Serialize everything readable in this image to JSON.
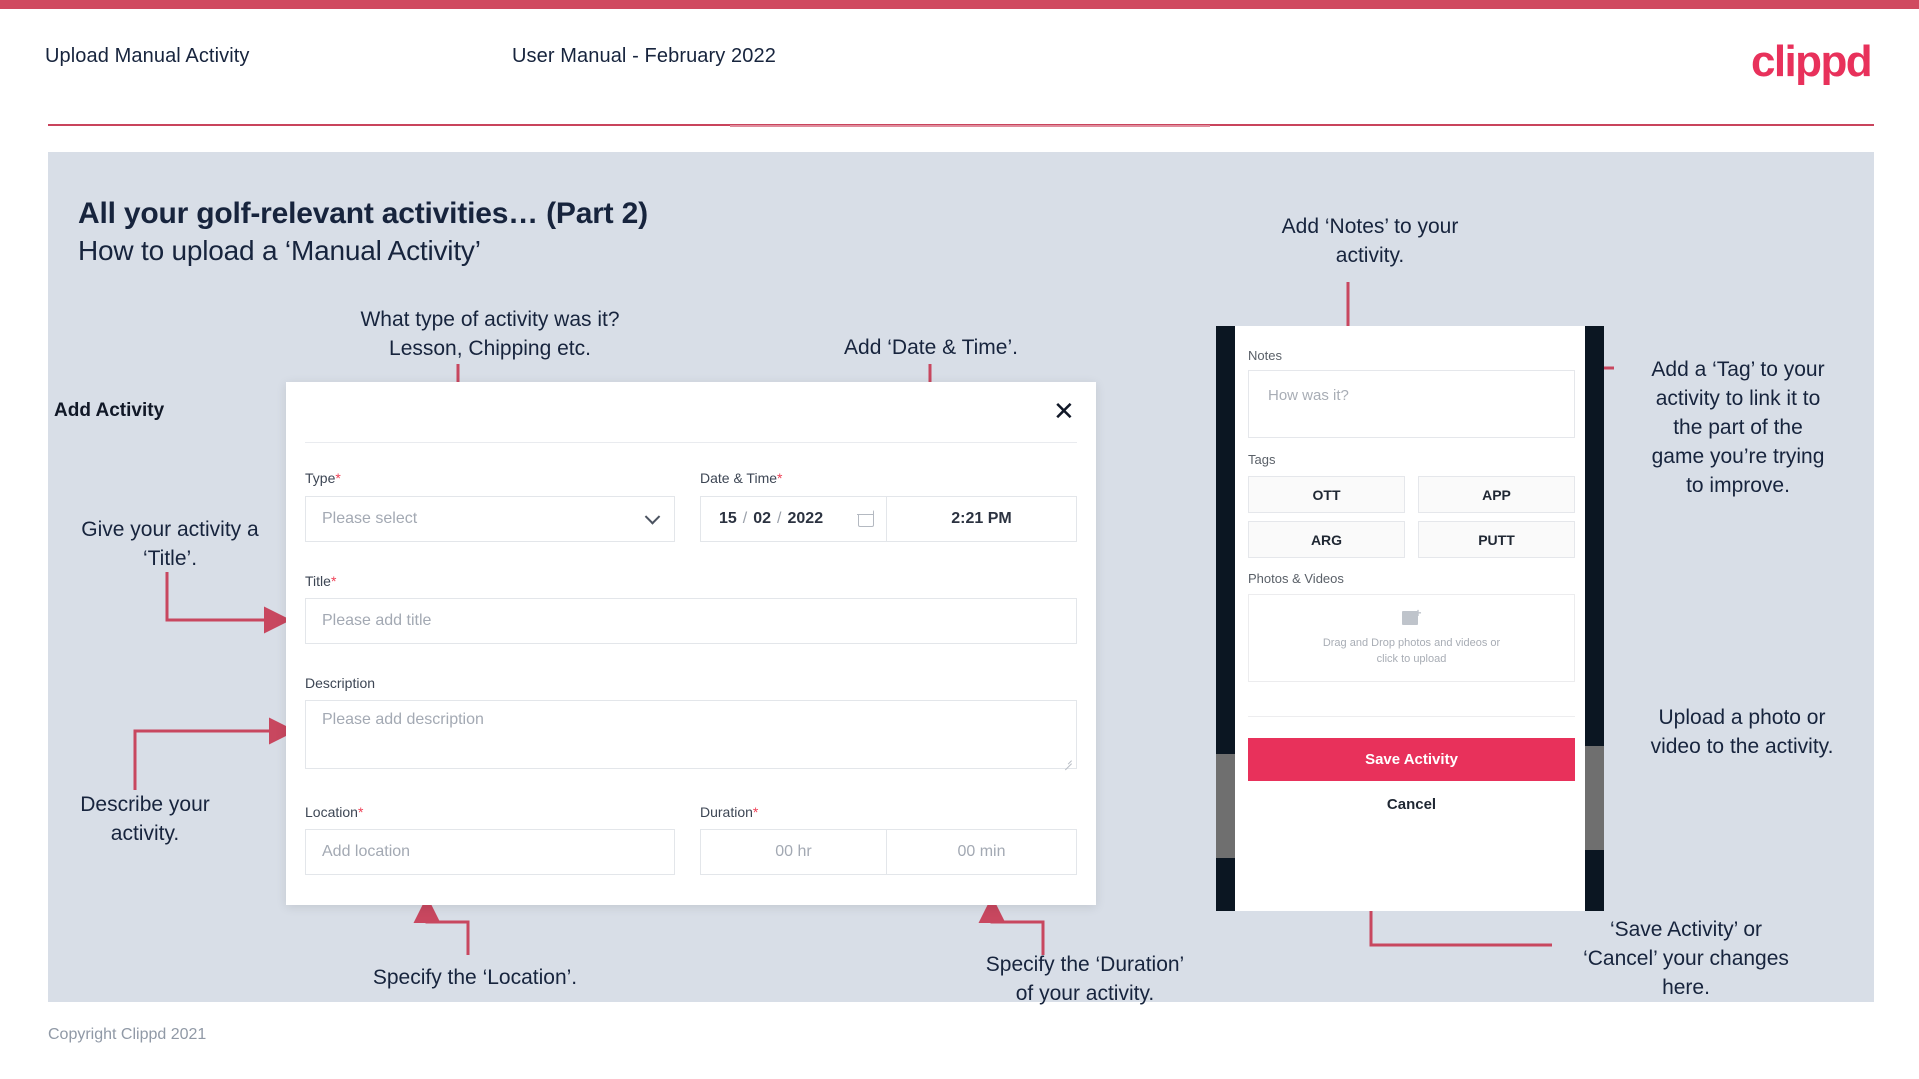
{
  "header": {
    "title": "Upload Manual Activity",
    "subtitle": "User Manual - February 2022",
    "logo": "clippd"
  },
  "slide": {
    "title": "All your golf-relevant activities… (Part 2)",
    "subtitle": "How to upload a ‘Manual Activity’"
  },
  "footer": {
    "copyright": "Copyright Clippd 2021"
  },
  "annotations": {
    "type": "What type of activity was it?\nLesson, Chipping etc.",
    "datetime": "Add ‘Date & Time’.",
    "title": "Give your activity a\n‘Title’.",
    "description": "Describe your\nactivity.",
    "location": "Specify the ‘Location’.",
    "duration": "Specify the ‘Duration’\nof your activity.",
    "notes": "Add ‘Notes’ to your\nactivity.",
    "tags": "Add a ‘Tag’ to your\nactivity to link it to\nthe part of the\ngame you’re trying\nto improve.",
    "upload": "Upload a photo or\nvideo to the activity.",
    "save_cancel": "‘Save Activity’ or\n‘Cancel’ your changes\nhere."
  },
  "dialog": {
    "title": "Add Activity",
    "close_icon": "close-icon",
    "fields": {
      "type": {
        "label": "Type",
        "required": "*",
        "placeholder": "Please select"
      },
      "datetime": {
        "label": "Date & Time",
        "required": "*",
        "day": "15",
        "month": "02",
        "year": "2022",
        "sep1": "/",
        "sep2": "/",
        "time": "2:21 PM"
      },
      "title": {
        "label": "Title",
        "required": "*",
        "placeholder": "Please add title"
      },
      "description": {
        "label": "Description",
        "required": "",
        "placeholder": "Please add description"
      },
      "location": {
        "label": "Location",
        "required": "*",
        "placeholder": "Add location"
      },
      "duration": {
        "label": "Duration",
        "required": "*",
        "hours": "00 hr",
        "minutes": "00 min"
      }
    }
  },
  "phone": {
    "notes": {
      "label": "Notes",
      "placeholder": "How was it?"
    },
    "tags": {
      "label": "Tags",
      "items": [
        "OTT",
        "APP",
        "ARG",
        "PUTT"
      ]
    },
    "photos": {
      "label": "Photos & Videos",
      "drop_line1": "Drag and Drop photos and videos or",
      "drop_line2": "click to upload",
      "icon": "image-add-icon"
    },
    "save_label": "Save Activity",
    "cancel_label": "Cancel"
  },
  "colors": {
    "accent": "#e8315b",
    "topbar": "#d04a60",
    "slide_bg": "#d8dee7",
    "text_dark": "#17243d",
    "connector": "#c8475f"
  }
}
